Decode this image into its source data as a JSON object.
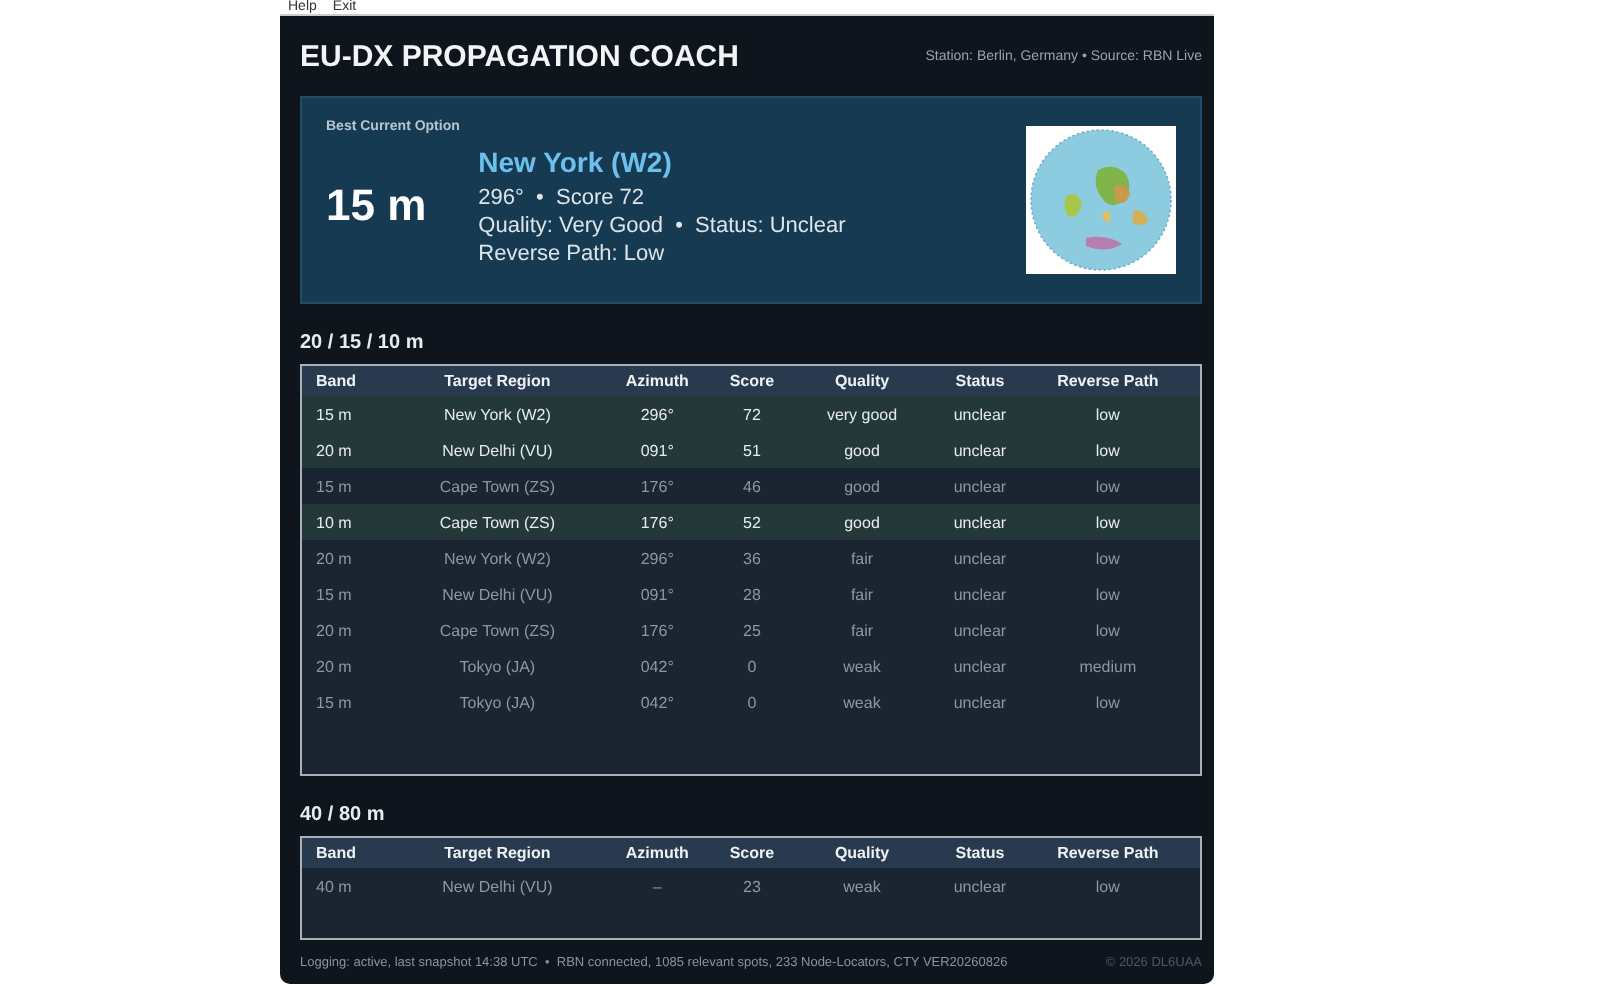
{
  "menu": [
    "Help",
    "Exit"
  ],
  "title": "EU-DX PROPAGATION COACH",
  "station": "Station: Berlin, Germany • Source: RBN Live",
  "best": {
    "label": "Best Current Option",
    "band": "15 m",
    "target": "New York (W2)",
    "line1": "296°  •  Score 72",
    "line2": "Quality: Very Good  •  Status: Unclear",
    "line3": "Reverse Path: Low"
  },
  "sections": [
    {
      "title": "20 / 15 / 10 m",
      "columns": [
        "Band",
        "Target Region",
        "Azimuth",
        "Score",
        "Quality",
        "Status",
        "Reverse Path"
      ],
      "rows": [
        {
          "cells": [
            "15 m",
            "New York (W2)",
            "296°",
            "72",
            "very good",
            "unclear",
            "low"
          ],
          "highlighted": true
        },
        {
          "cells": [
            "20 m",
            "New Delhi (VU)",
            "091°",
            "51",
            "good",
            "unclear",
            "low"
          ],
          "highlighted": true
        },
        {
          "cells": [
            "15 m",
            "Cape Town (ZS)",
            "176°",
            "46",
            "good",
            "unclear",
            "low"
          ],
          "highlighted": false
        },
        {
          "cells": [
            "10 m",
            "Cape Town (ZS)",
            "176°",
            "52",
            "good",
            "unclear",
            "low"
          ],
          "highlighted": true
        },
        {
          "cells": [
            "20 m",
            "New York (W2)",
            "296°",
            "36",
            "fair",
            "unclear",
            "low"
          ],
          "highlighted": false
        },
        {
          "cells": [
            "15 m",
            "New Delhi (VU)",
            "091°",
            "28",
            "fair",
            "unclear",
            "low"
          ],
          "highlighted": false
        },
        {
          "cells": [
            "20 m",
            "Cape Town (ZS)",
            "176°",
            "25",
            "fair",
            "unclear",
            "low"
          ],
          "highlighted": false
        },
        {
          "cells": [
            "20 m",
            "Tokyo (JA)",
            "042°",
            "0",
            "weak",
            "unclear",
            "medium"
          ],
          "highlighted": false
        },
        {
          "cells": [
            "15 m",
            "Tokyo (JA)",
            "042°",
            "0",
            "weak",
            "unclear",
            "low"
          ],
          "highlighted": false
        }
      ]
    },
    {
      "title": "40 / 80 m",
      "columns": [
        "Band",
        "Target Region",
        "Azimuth",
        "Score",
        "Quality",
        "Status",
        "Reverse Path"
      ],
      "rows": [
        {
          "cells": [
            "40 m",
            "New Delhi (VU)",
            "–",
            "23",
            "weak",
            "unclear",
            "low"
          ],
          "highlighted": false
        }
      ]
    }
  ],
  "status_bar": {
    "text": "Logging: active, last snapshot 14:38 UTC  •  RBN connected, 1085 relevant spots, 233 Node-Locators, CTY VER20260826",
    "copyright": "© 2026 DL6UAA"
  }
}
